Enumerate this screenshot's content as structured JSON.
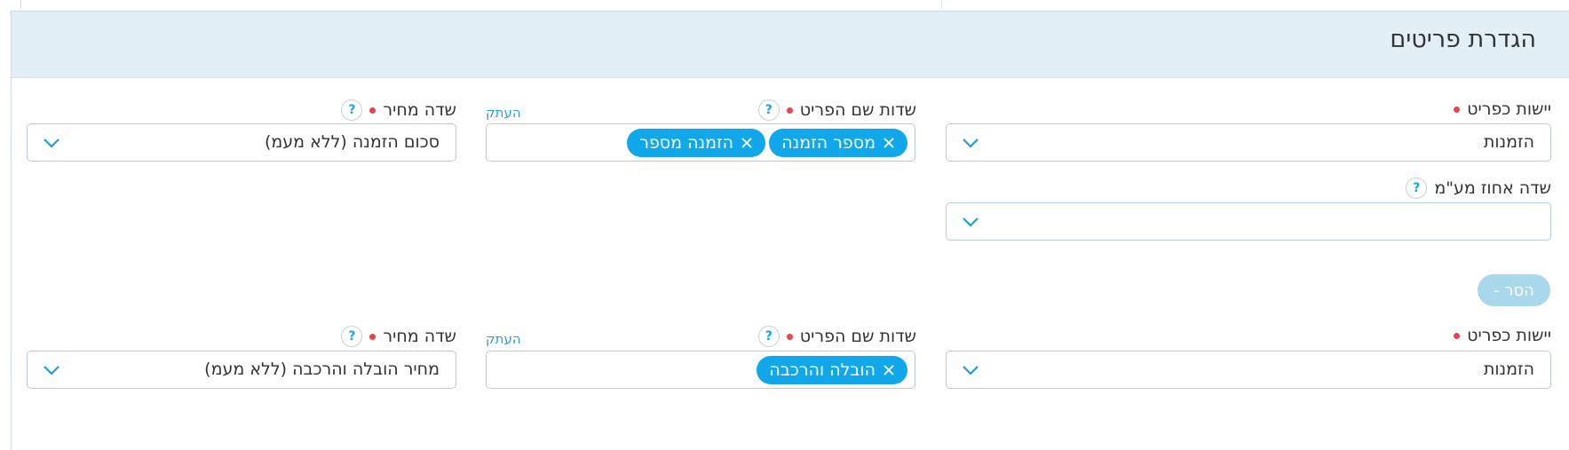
{
  "section": {
    "title": "הגדרת פריטים"
  },
  "row1": {
    "entity": {
      "label": "יישות כפריט",
      "value": "הזמנות"
    },
    "name_fields": {
      "label": "שדות שם הפריט",
      "copy": "העתק",
      "tags": [
        "מספר הזמנה",
        "הזמנה מספר"
      ]
    },
    "price": {
      "label": "שדה מחיר",
      "value": "סכום הזמנה (ללא מעמ)"
    },
    "vat": {
      "label": "שדה אחוז מע\"מ",
      "value": ""
    },
    "remove_button": "הסר -"
  },
  "row2": {
    "entity": {
      "label": "יישות כפריט",
      "value": "הזמנות"
    },
    "name_fields": {
      "label": "שדות שם הפריט",
      "copy": "העתק",
      "tags": [
        "הובלה והרכבה"
      ]
    },
    "price": {
      "label": "שדה מחיר",
      "value": "מחיר הובלה והרכבה (ללא מעמ)"
    }
  },
  "icons": {
    "help": "question-mark-icon",
    "dropdown": "chevron-down-icon",
    "tag_remove": "close-icon"
  },
  "colors": {
    "accent": "#10a8ea",
    "header_bg": "#e3eff7",
    "required": "#e2474f",
    "link": "#2a9fd6"
  }
}
